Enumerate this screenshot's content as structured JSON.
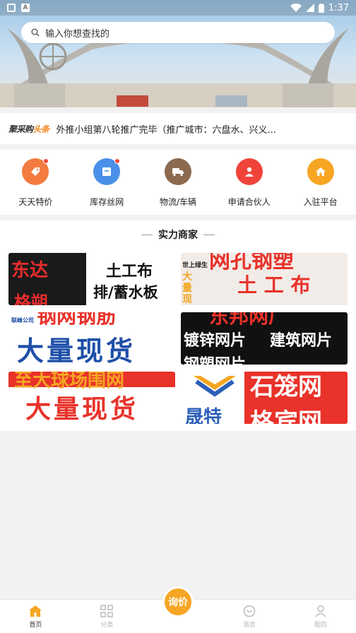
{
  "status_bar": {
    "time": "1:37"
  },
  "search": {
    "placeholder": "输入你想查找的"
  },
  "headline": {
    "logo_main": "聚采购",
    "logo_highlight": "头条",
    "text": "外推小组第八轮推广完毕（推广城市：六盘水、兴义..."
  },
  "categories": [
    {
      "label": "天天特价",
      "icon": "tag-icon",
      "color": "#f47b40",
      "badge": true
    },
    {
      "label": "库存丝网",
      "icon": "box-icon",
      "color": "#4a8fe8",
      "badge": true
    },
    {
      "label": "物流/车辆",
      "icon": "truck-icon",
      "color": "#8c6a4f",
      "badge": false
    },
    {
      "label": "申请合伙人",
      "icon": "person-icon",
      "color": "#f0433a",
      "badge": false
    },
    {
      "label": "入驻平台",
      "icon": "house-icon",
      "color": "#f6a623",
      "badge": false
    }
  ],
  "merchants": {
    "title": "实力商家",
    "tiles": [
      {
        "lines": [
          "东达",
          "土工布",
          "排/蓄水板",
          "格朔"
        ]
      },
      {
        "lines": [
          "网孔钢塑",
          "大量现",
          "土 工 布",
          "世上绿生"
        ]
      },
      {
        "lines": [
          "联峰公司",
          "钢网钢筋",
          "大量现货"
        ]
      },
      {
        "lines": [
          "东邦网厂",
          "镀锌网片",
          "建筑网片",
          "钢塑网片"
        ]
      },
      {
        "lines": [
          "至大球场围网",
          "大量现货"
        ]
      },
      {
        "lines": [
          "晟特",
          "石笼网",
          "格宾网"
        ]
      }
    ]
  },
  "bottom_nav": {
    "items": [
      {
        "label": "首页",
        "active": true
      },
      {
        "label": "分类",
        "active": false
      },
      {
        "label": "",
        "active": false
      },
      {
        "label": "消息",
        "active": false
      },
      {
        "label": "我的",
        "active": false
      }
    ],
    "center_button": "询价"
  },
  "colors": {
    "accent": "#f6a623",
    "brand_orange": "#f08a24"
  }
}
